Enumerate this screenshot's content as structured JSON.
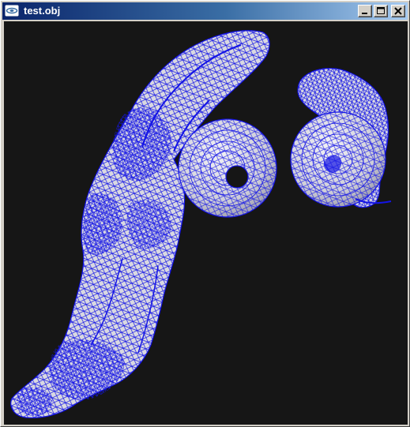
{
  "window": {
    "title": "test.obj"
  },
  "icons": {
    "app": "app-icon",
    "minimize": "minimize-icon",
    "maximize": "maximize-icon",
    "close": "close-icon"
  },
  "colors": {
    "viewport_background": "#161616",
    "mesh_fill": "#d9d9e0",
    "wireframe": "#1414e6",
    "titlebar_start": "#0a246a",
    "titlebar_end": "#a6caf0"
  }
}
